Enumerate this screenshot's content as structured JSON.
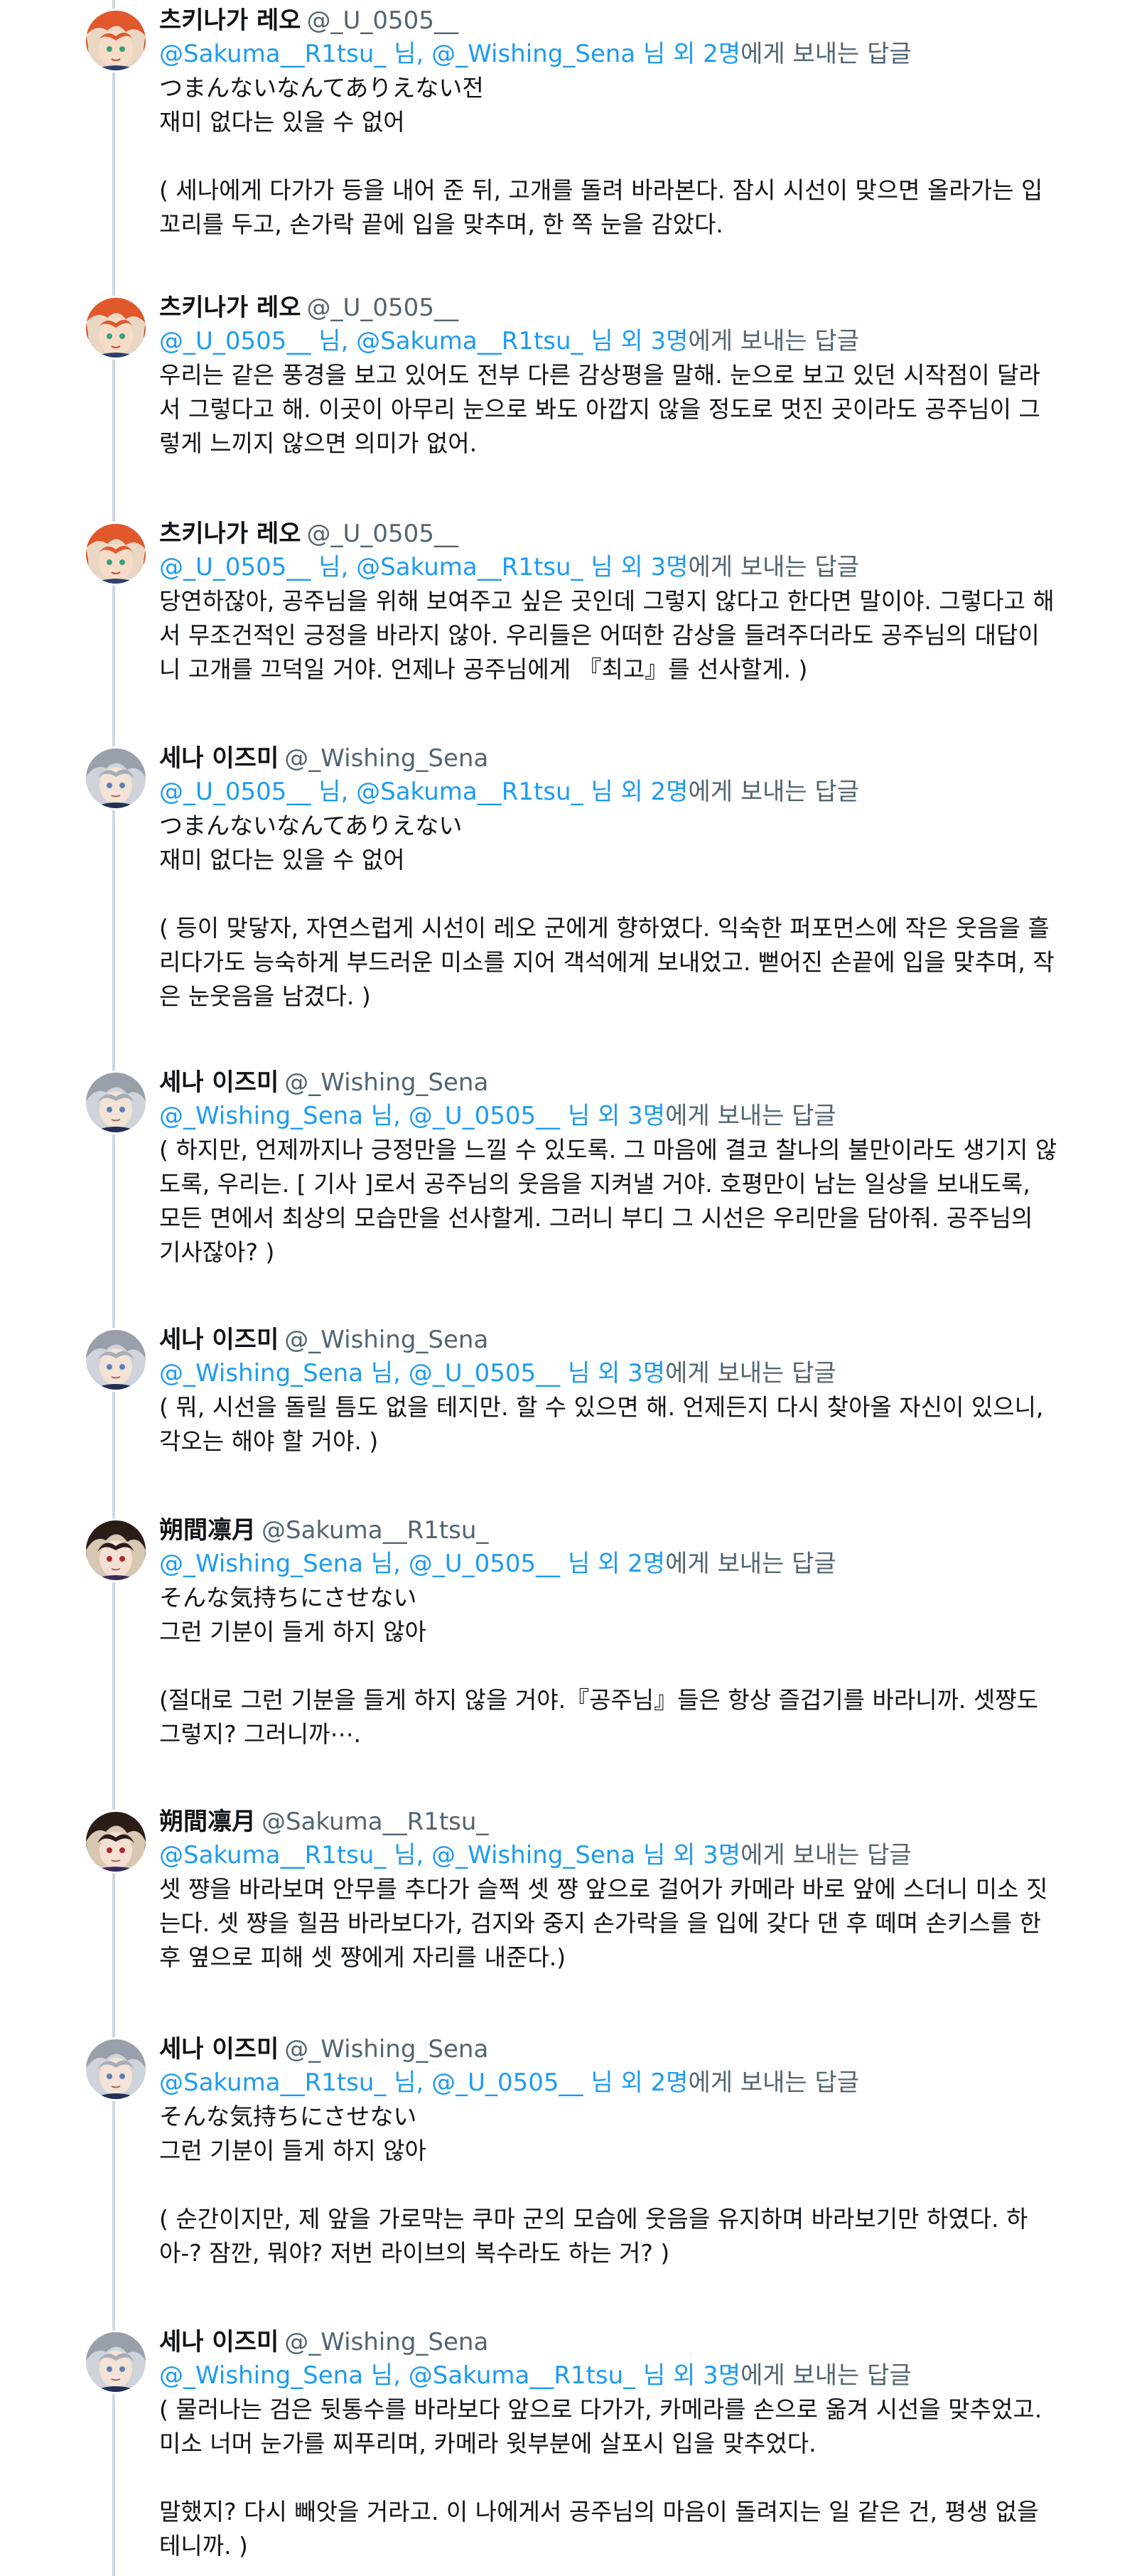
{
  "replying_suffix": "에게 보내는 답글",
  "tweets": [
    {
      "name": "츠키나가 레오",
      "handle": "@_U_0505__",
      "avatar": "leo",
      "reply_to": [
        "@Sakuma__R1tsu_ 님",
        "@_Wishing_Sena 님"
      ],
      "others": " 외 2명",
      "paragraphs": [
        "つまんないなんてありえない전\n재미 없다는 있을 수 없어",
        "( 세나에게 다가가 등을 내어 준 뒤, 고개를 돌려 바라본다. 잠시 시선이 맞으면 올라가는 입꼬리를 두고, 손가락 끝에 입을 맞추며, 한 쪽 눈을 감았다."
      ]
    },
    {
      "name": "츠키나가 레오",
      "handle": "@_U_0505__",
      "avatar": "leo",
      "reply_to": [
        "@_U_0505__ 님",
        "@Sakuma__R1tsu_ 님"
      ],
      "others": " 외 3명",
      "paragraphs": [
        "우리는 같은 풍경을 보고 있어도 전부 다른 감상평을 말해. 눈으로 보고 있던 시작점이 달라서 그렇다고 해. 이곳이 아무리 눈으로 봐도 아깝지 않을 정도로 멋진 곳이라도 공주님이 그렇게 느끼지 않으면 의미가 없어."
      ]
    },
    {
      "name": "츠키나가 레오",
      "handle": "@_U_0505__",
      "avatar": "leo",
      "reply_to": [
        "@_U_0505__ 님",
        "@Sakuma__R1tsu_ 님"
      ],
      "others": " 외 3명",
      "paragraphs": [
        "당연하잖아, 공주님을 위해 보여주고 싶은 곳인데 그렇지 않다고 한다면 말이야. 그렇다고 해서 무조건적인 긍정을 바라지 않아. 우리들은 어떠한 감상을 들려주더라도 공주님의 대답이니 고개를 끄덕일 거야. 언제나 공주님에게 『최고』를 선사할게. )"
      ]
    },
    {
      "name": "세나 이즈미",
      "handle": "@_Wishing_Sena",
      "avatar": "sena",
      "reply_to": [
        "@_U_0505__ 님",
        "@Sakuma__R1tsu_ 님"
      ],
      "others": " 외 2명",
      "paragraphs": [
        "つまんないなんてありえない\n재미 없다는 있을 수 없어",
        "( 등이 맞닿자, 자연스럽게 시선이 레오 군에게 향하였다. 익숙한 퍼포먼스에 작은 웃음을 흘리다가도 능숙하게 부드러운 미소를 지어 객석에게 보내었고. 뻗어진 손끝에 입을 맞추며, 작은 눈웃음을 남겼다. )"
      ]
    },
    {
      "name": "세나 이즈미",
      "handle": "@_Wishing_Sena",
      "avatar": "sena",
      "reply_to": [
        "@_Wishing_Sena 님",
        "@_U_0505__ 님"
      ],
      "others": " 외 3명",
      "paragraphs": [
        "( 하지만, 언제까지나 긍정만을 느낄 수 있도록. 그 마음에 결코 찰나의 불만이라도 생기지 않도록, 우리는. [ 기사 ]로서 공주님의 웃음을 지켜낼 거야. 호평만이 남는 일상을 보내도록, 모든 면에서 최상의 모습만을 선사할게. 그러니 부디 그 시선은 우리만을 담아줘. 공주님의 기사잖아? )"
      ]
    },
    {
      "name": "세나 이즈미",
      "handle": "@_Wishing_Sena",
      "avatar": "sena",
      "reply_to": [
        "@_Wishing_Sena 님",
        "@_U_0505__ 님"
      ],
      "others": " 외 3명",
      "paragraphs": [
        "( 뭐, 시선을 돌릴 틈도 없을 테지만. 할 수 있으면 해. 언제든지 다시 찾아올 자신이 있으니, 각오는 해야 할 거야. )"
      ]
    },
    {
      "name": "朔間凛月",
      "handle": "@Sakuma__R1tsu_",
      "avatar": "ritsu",
      "reply_to": [
        "@_Wishing_Sena 님",
        "@_U_0505__ 님"
      ],
      "others": " 외 2명",
      "paragraphs": [
        "そんな気持ちにさせない\n그런 기분이 들게 하지 않아",
        "(절대로 그런 기분을 들게 하지 않을 거야.『공주님』들은 항상 즐겁기를 바라니까. 셋쨩도 그렇지? 그러니까⋯."
      ]
    },
    {
      "name": "朔間凛月",
      "handle": "@Sakuma__R1tsu_",
      "avatar": "ritsu",
      "reply_to": [
        "@Sakuma__R1tsu_ 님",
        "@_Wishing_Sena 님"
      ],
      "others": " 외 3명",
      "paragraphs": [
        "셋 쨩을 바라보며 안무를 추다가 슬쩍 셋 쨩 앞으로 걸어가 카메라 바로 앞에 스더니 미소 짓는다. 셋 쨩을 힐끔 바라보다가, 검지와 중지 손가락을 을 입에 갖다 댄 후 떼며 손키스를 한 후 옆으로 피해 셋 쨩에게 자리를 내준다.)"
      ]
    },
    {
      "name": "세나 이즈미",
      "handle": "@_Wishing_Sena",
      "avatar": "sena",
      "reply_to": [
        "@Sakuma__R1tsu_ 님",
        "@_U_0505__ 님"
      ],
      "others": " 외 2명",
      "paragraphs": [
        "そんな気持ちにさせない\n그런 기분이 들게 하지 않아",
        "( 순간이지만, 제 앞을 가로막는 쿠마 군의 모습에 웃음을 유지하며 바라보기만 하였다. 하아-? 잠깐, 뭐야? 저번 라이브의 복수라도 하는 거? )"
      ]
    },
    {
      "name": "세나 이즈미",
      "handle": "@_Wishing_Sena",
      "avatar": "sena",
      "reply_to": [
        "@_Wishing_Sena 님",
        "@Sakuma__R1tsu_ 님"
      ],
      "others": " 외 3명",
      "paragraphs": [
        "( 물러나는 검은 뒷통수를 바라보다 앞으로 다가가, 카메라를 손으로 옮겨 시선을 맞추었고. 미소 너머 눈가를 찌푸리며, 카메라 윗부분에 살포시 입을 맞추었다.",
        "말했지? 다시 빼앗을 거라고. 이 나에게서 공주님의 마음이 돌려지는 일 같은 건, 평생 없을 테니까. )"
      ]
    }
  ]
}
